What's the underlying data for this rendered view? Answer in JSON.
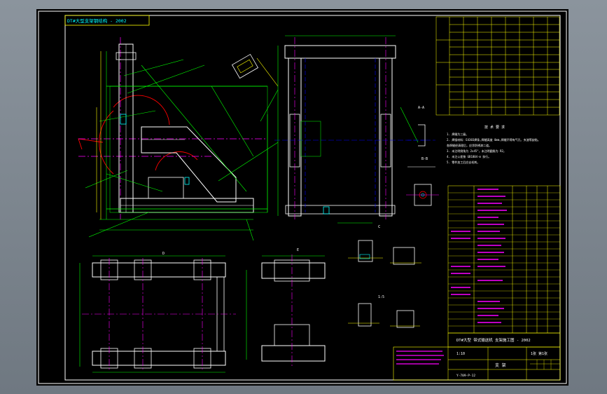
{
  "drawing": {
    "frame_title": "DT#大型支架钢结构 - 2002",
    "view_labels": [
      "A-A",
      "B-B",
      "C",
      "D",
      "E",
      "1:5"
    ],
    "tech_requirements": {
      "heading": "技 术 要 求",
      "lines": [
        "1. 焊缝为三级。",
        "2. 焊接材料：E4303焊条,焊缝高度 8mm,焊缝不得有气孔、夹渣等缺陷。",
        "   各焊缝经清理后，应涂防锈漆二道。",
        "3. 未注明倒角为 2x45°，未注明圆角为 R2。",
        "4. 未注公差按 GB1804-m 执行。",
        "5. 零件加工后应去毛刺。"
      ]
    },
    "title_block": {
      "project": "DT#大型 带式输送机 支架施工图 - 2002",
      "scale": "1:10",
      "sheet": "1张 第1张",
      "name": "支 架",
      "drawing_no": "Y-709-P-12"
    }
  }
}
